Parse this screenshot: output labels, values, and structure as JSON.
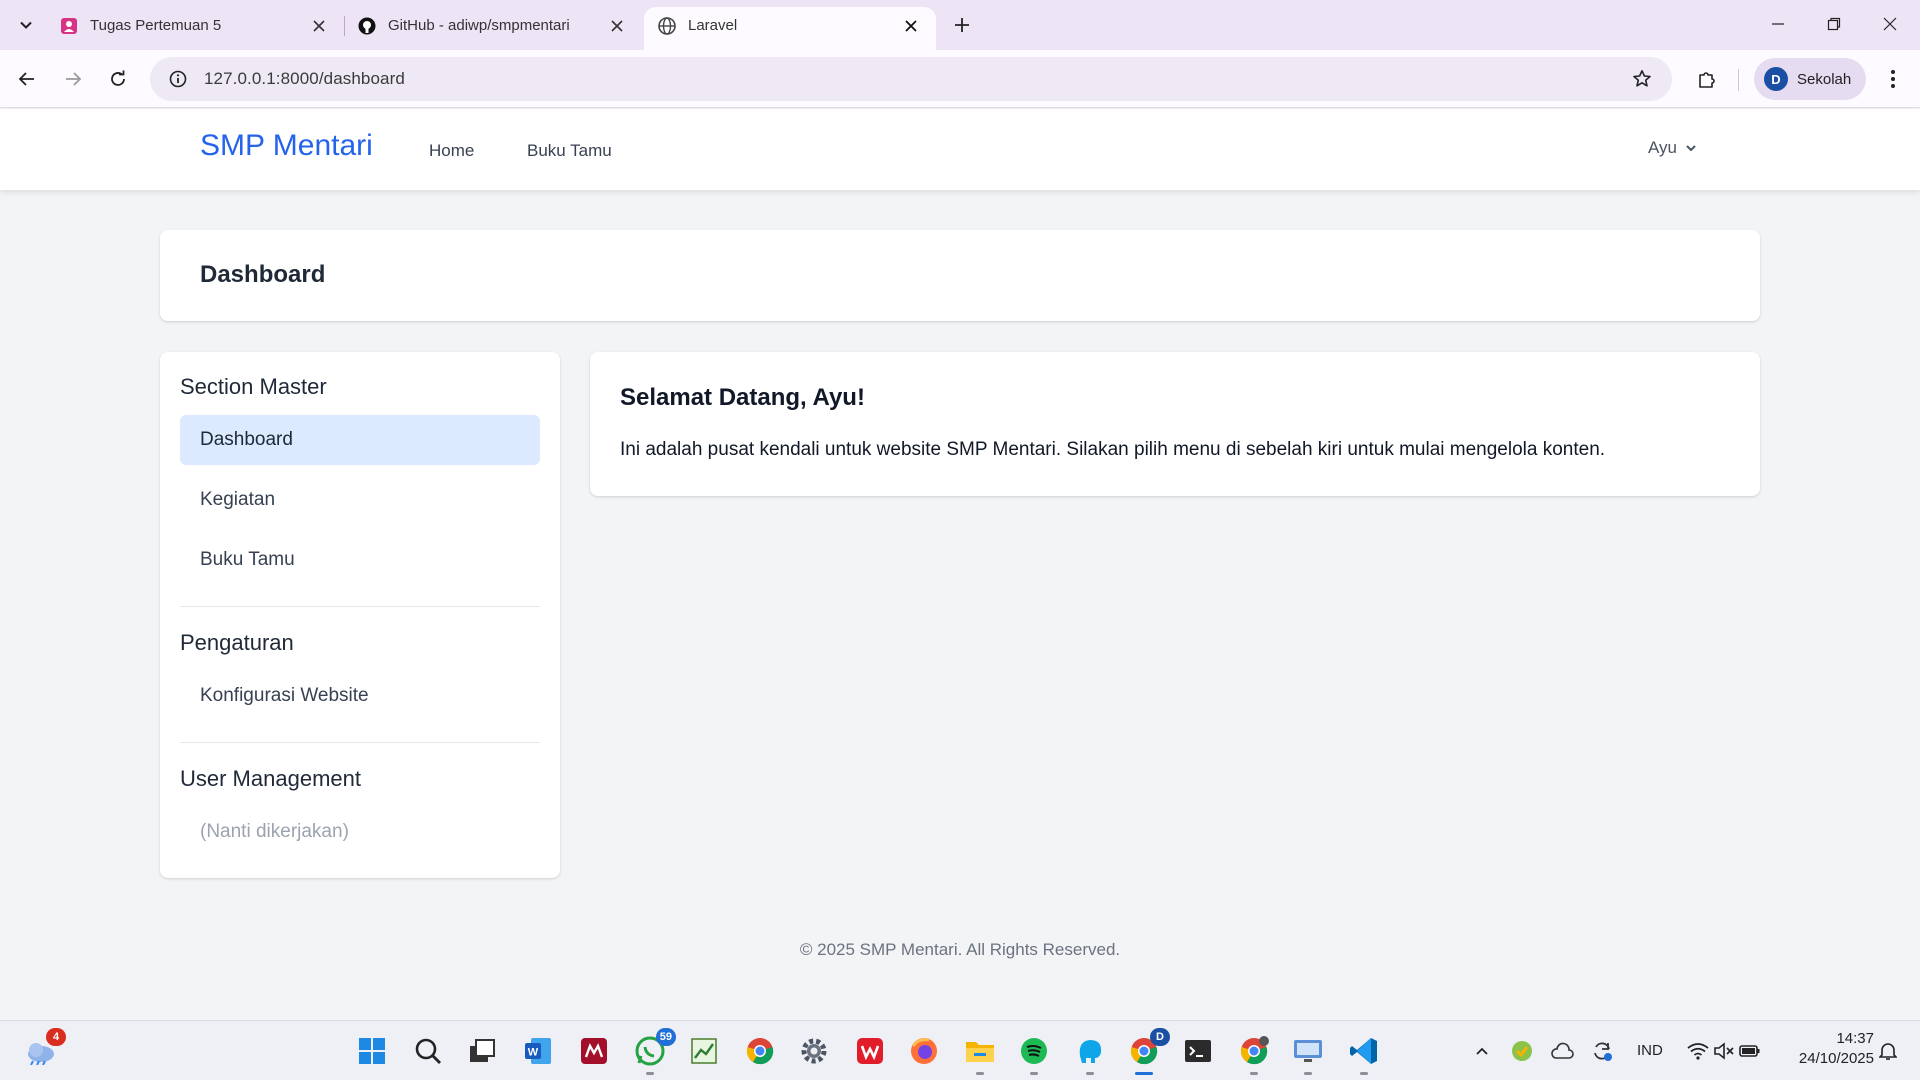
{
  "browser": {
    "tabs": [
      {
        "title": "Tugas Pertemuan 5",
        "favicon": "classroom-icon"
      },
      {
        "title": "GitHub - adiwp/smpmentari",
        "favicon": "github-icon"
      },
      {
        "title": "Laravel",
        "favicon": "globe-icon",
        "active": true
      }
    ],
    "url": "127.0.0.1:8000/dashboard",
    "profile": {
      "initial": "D",
      "name": "Sekolah"
    }
  },
  "site": {
    "brand": "SMP Mentari",
    "nav": {
      "home": "Home",
      "guestbook": "Buku Tamu"
    },
    "user": "Ayu"
  },
  "page": {
    "header_title": "Dashboard",
    "sidebar": {
      "section_master": "Section Master",
      "items_master": [
        "Dashboard",
        "Kegiatan",
        "Buku Tamu"
      ],
      "section_settings": "Pengaturan",
      "items_settings": [
        "Konfigurasi Website"
      ],
      "section_users": "User Management",
      "users_placeholder": "(Nanti dikerjakan)"
    },
    "welcome": {
      "title": "Selamat Datang, Ayu!",
      "text": "Ini adalah pusat kendali untuk website SMP Mentari. Silakan pilih menu di sebelah kiri untuk mulai mengelola konten."
    },
    "footer": "© 2025 SMP Mentari. All Rights Reserved."
  },
  "taskbar": {
    "weather_badge": "4",
    "whatsapp_badge": "59",
    "chrome_profile_badge": "D",
    "language": "IND",
    "time": "14:37",
    "date": "24/10/2025"
  },
  "colors": {
    "brand": "#2563eb",
    "active_item_bg": "#dbeafe",
    "page_bg": "#f3f4f6",
    "browser_frame": "#ede4f6"
  }
}
